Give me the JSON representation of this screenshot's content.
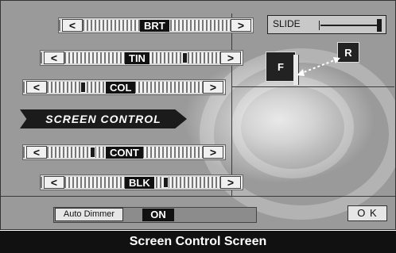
{
  "screen": {
    "title": "SCREEN CONTROL",
    "controls": [
      {
        "label": "BRT",
        "level": 0.0
      },
      {
        "label": "TIN",
        "level": 0.78
      },
      {
        "label": "COL",
        "level": 0.35
      },
      {
        "label": "CONT",
        "level": 0.42
      },
      {
        "label": "BLK",
        "level": 0.88
      }
    ],
    "left_arrow": "<",
    "right_arrow": ">",
    "slide": {
      "label": "SLIDE",
      "level": 1.0
    },
    "front_label": "F",
    "rear_label": "R",
    "auto_dimmer": {
      "label": "Auto Dimmer",
      "value": "ON"
    },
    "ok_label": "O K"
  },
  "caption": "Screen Control Screen"
}
